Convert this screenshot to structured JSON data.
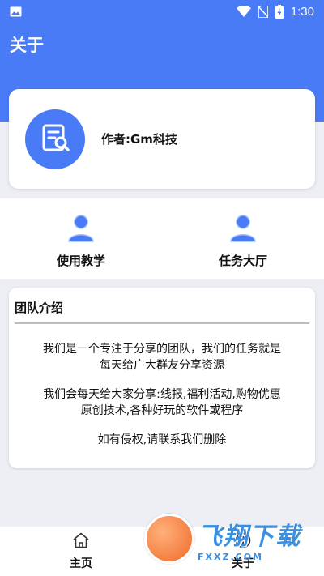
{
  "status_bar": {
    "time": "1:30",
    "icons": [
      "image-icon",
      "wifi-icon",
      "no-sim-icon",
      "battery-charging-icon"
    ]
  },
  "header": {
    "title": "关于"
  },
  "author": {
    "label": "作者:Gm科技",
    "avatar_icon": "document-edit-icon"
  },
  "menu": {
    "items": [
      {
        "label": "使用教学",
        "icon": "user-icon"
      },
      {
        "label": "任务大厅",
        "icon": "user-icon"
      }
    ]
  },
  "team": {
    "title": "团队介绍",
    "paragraphs": [
      [
        "我们是一个专注于分享的团队，我们的任务就是",
        "每天给广大群友分享资源"
      ],
      [
        "我们会每天给大家分享:线报,福利活动,购物优惠",
        "原创技术,各种好玩的软件或程序"
      ],
      [
        "如有侵权,请联系我们删除"
      ]
    ]
  },
  "bottom_nav": {
    "items": [
      {
        "label": "主页",
        "icon": "home-icon"
      },
      {
        "label": "关于",
        "icon": "info-icon"
      }
    ]
  },
  "watermark": {
    "name": "飞翔下载",
    "domain": "FXXZ.COM"
  },
  "colors": {
    "primary": "#4a7bf7",
    "background": "#eeeff4",
    "card": "#ffffff"
  }
}
